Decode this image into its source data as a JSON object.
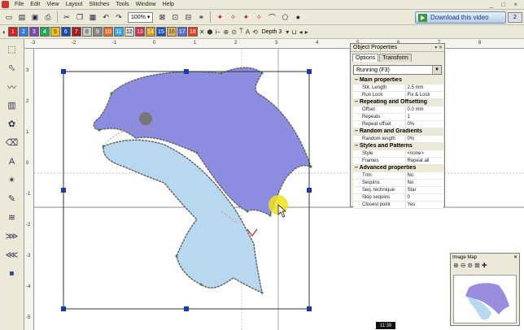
{
  "menu": [
    "File",
    "Edit",
    "View",
    "Layout",
    "Stitches",
    "Tools",
    "Window",
    "Help"
  ],
  "window_controls": "_ □ ×",
  "toolbar1": {
    "zoom": "100%",
    "download_label": "Download this video",
    "page_indicator": "2"
  },
  "toolbar2": {
    "color_chips": [
      {
        "label": "1",
        "color": "#d42020"
      },
      {
        "label": "2",
        "color": "#3a7ad8"
      },
      {
        "label": "3",
        "color": "#7a4aa8"
      },
      {
        "label": "4",
        "color": "#2aa85a"
      },
      {
        "label": "5",
        "color": "#e8c020"
      },
      {
        "label": "6",
        "color": "#1a4aa8"
      },
      {
        "label": "7",
        "color": "#a02020"
      },
      {
        "label": "8",
        "color": "#c8c8c8"
      },
      {
        "label": "9",
        "color": "#888888"
      },
      {
        "label": "10",
        "color": "#e07030"
      },
      {
        "label": "11",
        "color": "#3aa8d8"
      },
      {
        "label": "12",
        "color": "#d8d8d8"
      },
      {
        "label": "13",
        "color": "#c83050"
      },
      {
        "label": "14",
        "color": "#d8a020"
      },
      {
        "label": "15",
        "color": "#2050c0"
      },
      {
        "label": "16",
        "color": "#e0b060"
      },
      {
        "label": "17",
        "color": "#5a70c8"
      },
      {
        "label": "18",
        "color": "#e04020"
      }
    ],
    "depth_label": "Depth 3"
  },
  "ruler_top": [
    "-3",
    "-2",
    "-1",
    "0",
    "1",
    "2",
    "3",
    "4",
    "5",
    "6",
    "7",
    "8"
  ],
  "ruler_left": [
    "3",
    "2",
    "1",
    "0",
    "-1",
    "-2",
    "-3",
    "-4",
    "-5"
  ],
  "timecode": "11:38",
  "properties": {
    "title": "Object Properties",
    "tabs": [
      "Options",
      "Transform"
    ],
    "stitch_type": "Running (F3)",
    "sections": [
      {
        "name": "Main properties",
        "rows": [
          [
            "Stit. Length",
            "2.5 mm"
          ],
          [
            "Run Lock",
            "Fix & Lock"
          ]
        ]
      },
      {
        "name": "Repeating and Offsetting",
        "rows": [
          [
            "Offset",
            "0.0 mm"
          ],
          [
            "Repeats",
            "1"
          ],
          [
            "Repeat offset",
            "0%"
          ]
        ]
      },
      {
        "name": "Random and Gradients",
        "rows": [
          [
            "Random length",
            "0%"
          ]
        ]
      },
      {
        "name": "Styles and Patterns",
        "rows": [
          [
            "Style",
            "<none>"
          ],
          [
            "Frames",
            "Repeat all"
          ]
        ]
      },
      {
        "name": "Advanced properties",
        "rows": [
          [
            "Trim",
            "No"
          ],
          [
            "Sequins",
            "No"
          ],
          [
            "Seq. technique",
            "Star"
          ],
          [
            "Skip sequins",
            "0"
          ],
          [
            "Closest point",
            "Yes"
          ]
        ]
      }
    ]
  },
  "overview": {
    "title": "Image Map"
  },
  "colors": {
    "dolphin_body": "#8c8ce0",
    "dolphin_belly": "#b8d8f0",
    "outline": "#6a6a6a",
    "selection": "#222266",
    "cursor": "#f0e020"
  }
}
